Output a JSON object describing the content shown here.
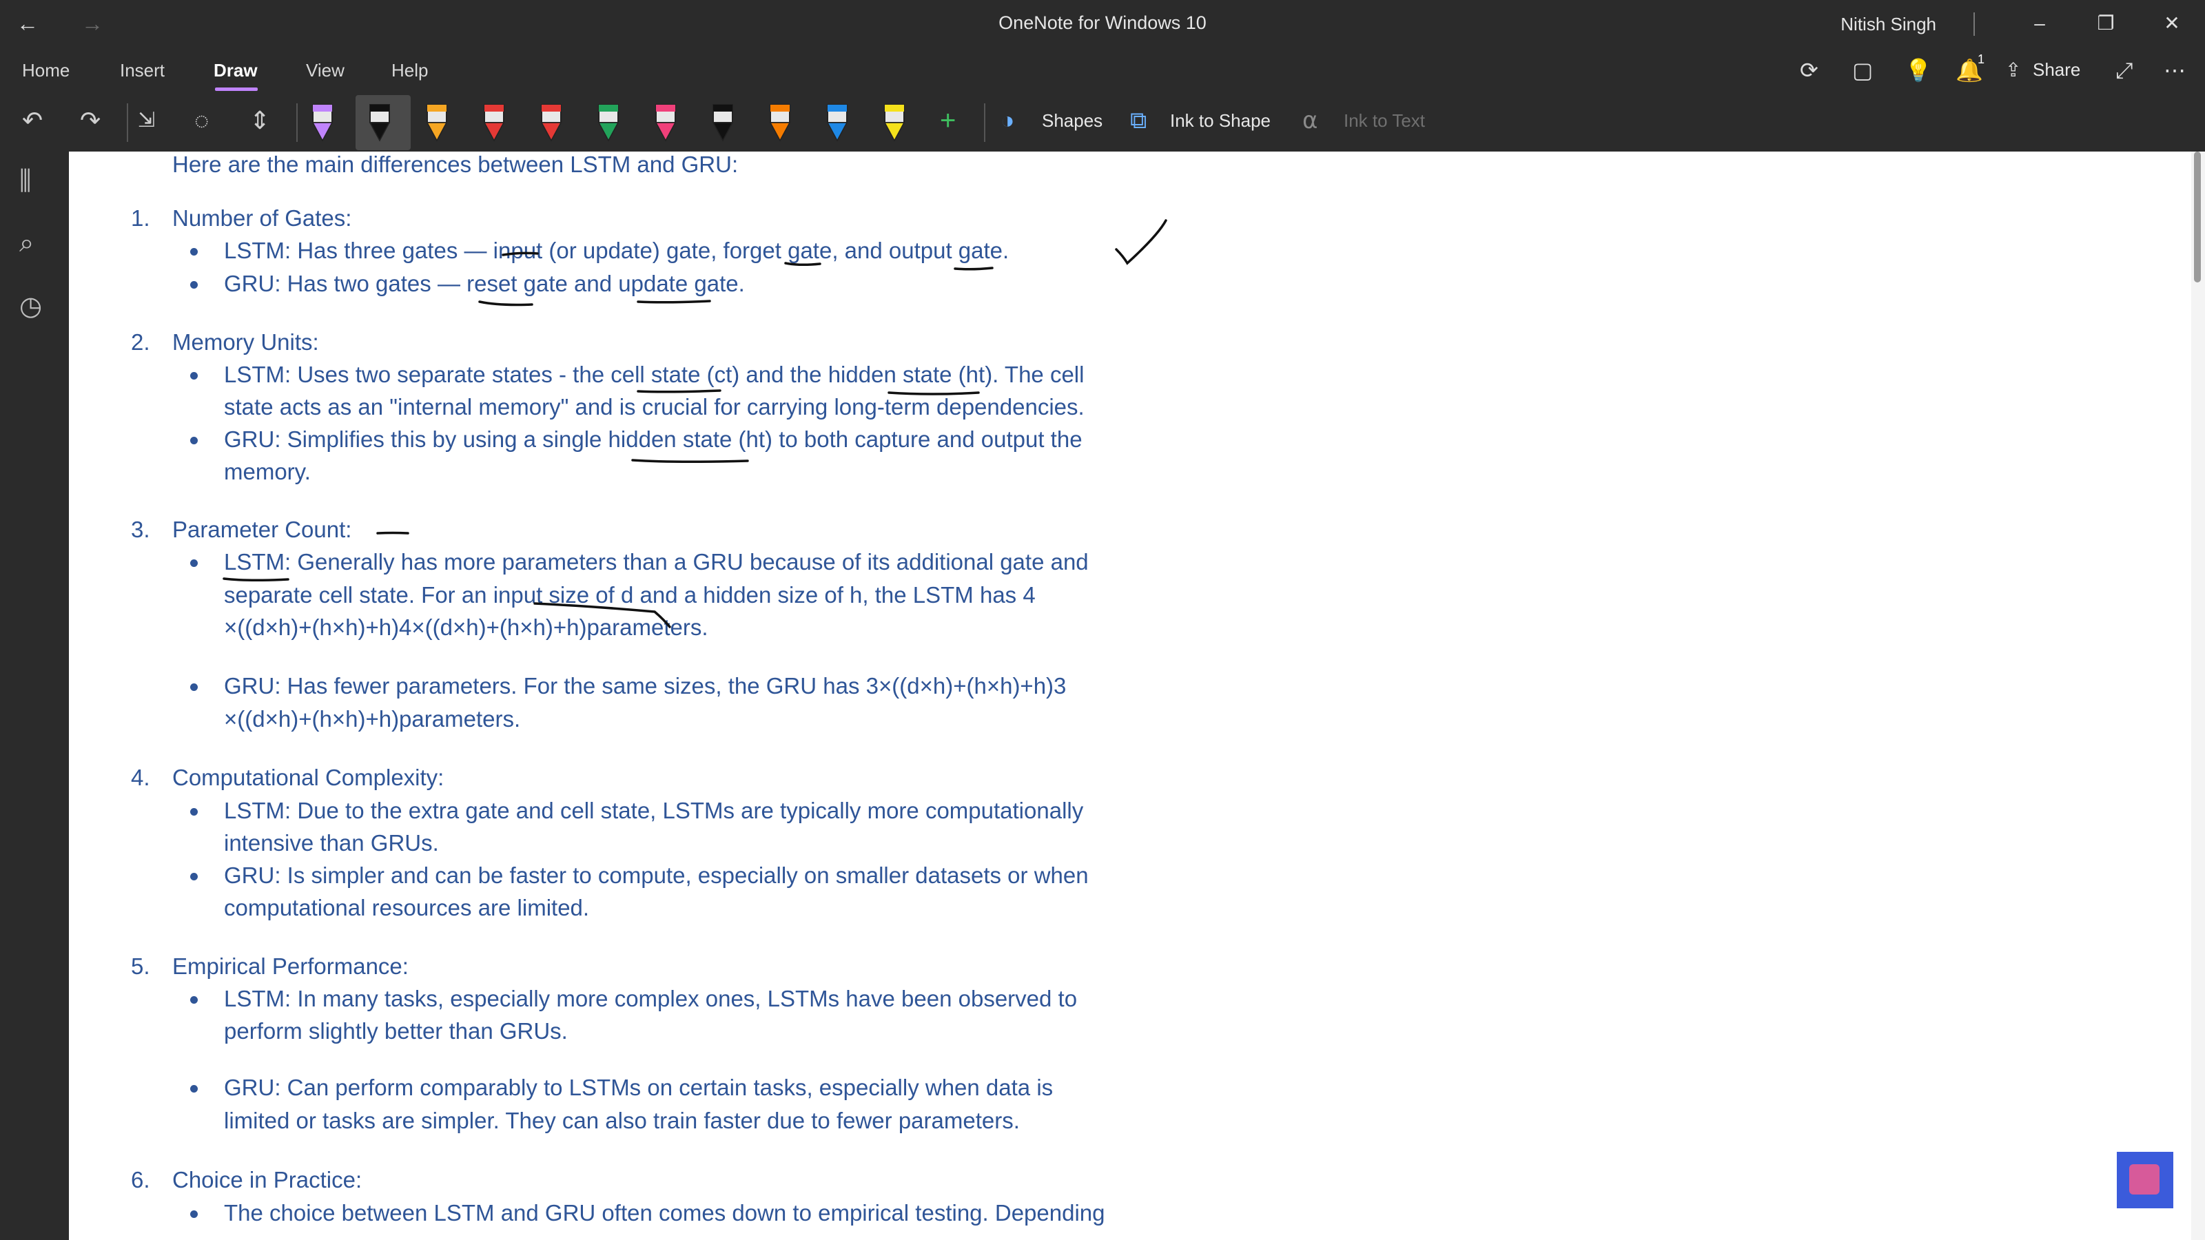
{
  "window": {
    "title": "OneNote for Windows 10",
    "user": "Nitish Singh",
    "back_icon": "←",
    "forward_icon": "→",
    "minimize_icon": "–",
    "restore_icon": "❐",
    "close_icon": "✕"
  },
  "menu": {
    "items": [
      "Home",
      "Insert",
      "Draw",
      "View",
      "Help"
    ],
    "active": "Draw",
    "share_label": "Share",
    "notification_count": "1"
  },
  "toolbar": {
    "shapes_label": "Shapes",
    "ink_to_shape_label": "Ink to Shape",
    "ink_to_text_label": "Ink to Text",
    "pen_colors": [
      "#c084fc",
      "#111111",
      "#f5a623",
      "#e53935",
      "#e53935",
      "#22a35a",
      "#f0407a",
      "#111111",
      "#f57c00",
      "#1e88e5",
      "#f5e11b"
    ]
  },
  "note": {
    "intro": "Here are the main differences between LSTM and GRU:",
    "sections": [
      {
        "number": "1.",
        "heading": "Number of Gates:",
        "bullets": [
          [
            "LSTM: Has three gates — input (or update) gate, forget gate, and output gate."
          ],
          [
            "GRU: Has two gates — reset gate and update gate."
          ]
        ]
      },
      {
        "number": "2.",
        "heading": "Memory Units:",
        "bullets": [
          [
            "LSTM: Uses two separate states - the cell state (ct) and the hidden state (ht). The cell",
            "state acts as an \"internal memory\" and is crucial for carrying long-term dependencies."
          ],
          [
            "GRU: Simplifies this by using a single hidden state (ht) to both capture and output the",
            "memory."
          ]
        ]
      },
      {
        "number": "3.",
        "heading": "Parameter Count:",
        "bullets": [
          [
            "LSTM: Generally has more parameters than a GRU because of its additional gate and",
            "separate cell state. For an input size of d and a hidden size of h, the LSTM has 4",
            "×((d×h)+(h×h)+h)4×((d×h)+(h×h)+h)parameters."
          ],
          [
            "GRU: Has fewer parameters. For the same sizes, the GRU has 3×((d×h)+(h×h)+h)3",
            "×((d×h)+(h×h)+h)parameters."
          ]
        ]
      },
      {
        "number": "4.",
        "heading": "Computational Complexity:",
        "bullets": [
          [
            "LSTM: Due to the extra gate and cell state, LSTMs are typically more computationally",
            "intensive than GRUs."
          ],
          [
            "GRU: Is simpler and can be faster to compute, especially on smaller datasets or when",
            "computational resources are limited."
          ]
        ]
      },
      {
        "number": "5.",
        "heading": "Empirical Performance:",
        "bullets": [
          [
            "LSTM: In many tasks, especially more complex ones, LSTMs have been observed to",
            "perform slightly better than GRUs."
          ],
          [
            "GRU: Can perform comparably to LSTMs on certain tasks, especially when data is",
            "limited or tasks are simpler. They can also train faster due to fewer parameters."
          ]
        ]
      },
      {
        "number": "6.",
        "heading": "Choice in Practice:",
        "bullets": [
          [
            "The choice between LSTM and GRU often comes down to empirical testing. Depending"
          ]
        ]
      }
    ]
  }
}
